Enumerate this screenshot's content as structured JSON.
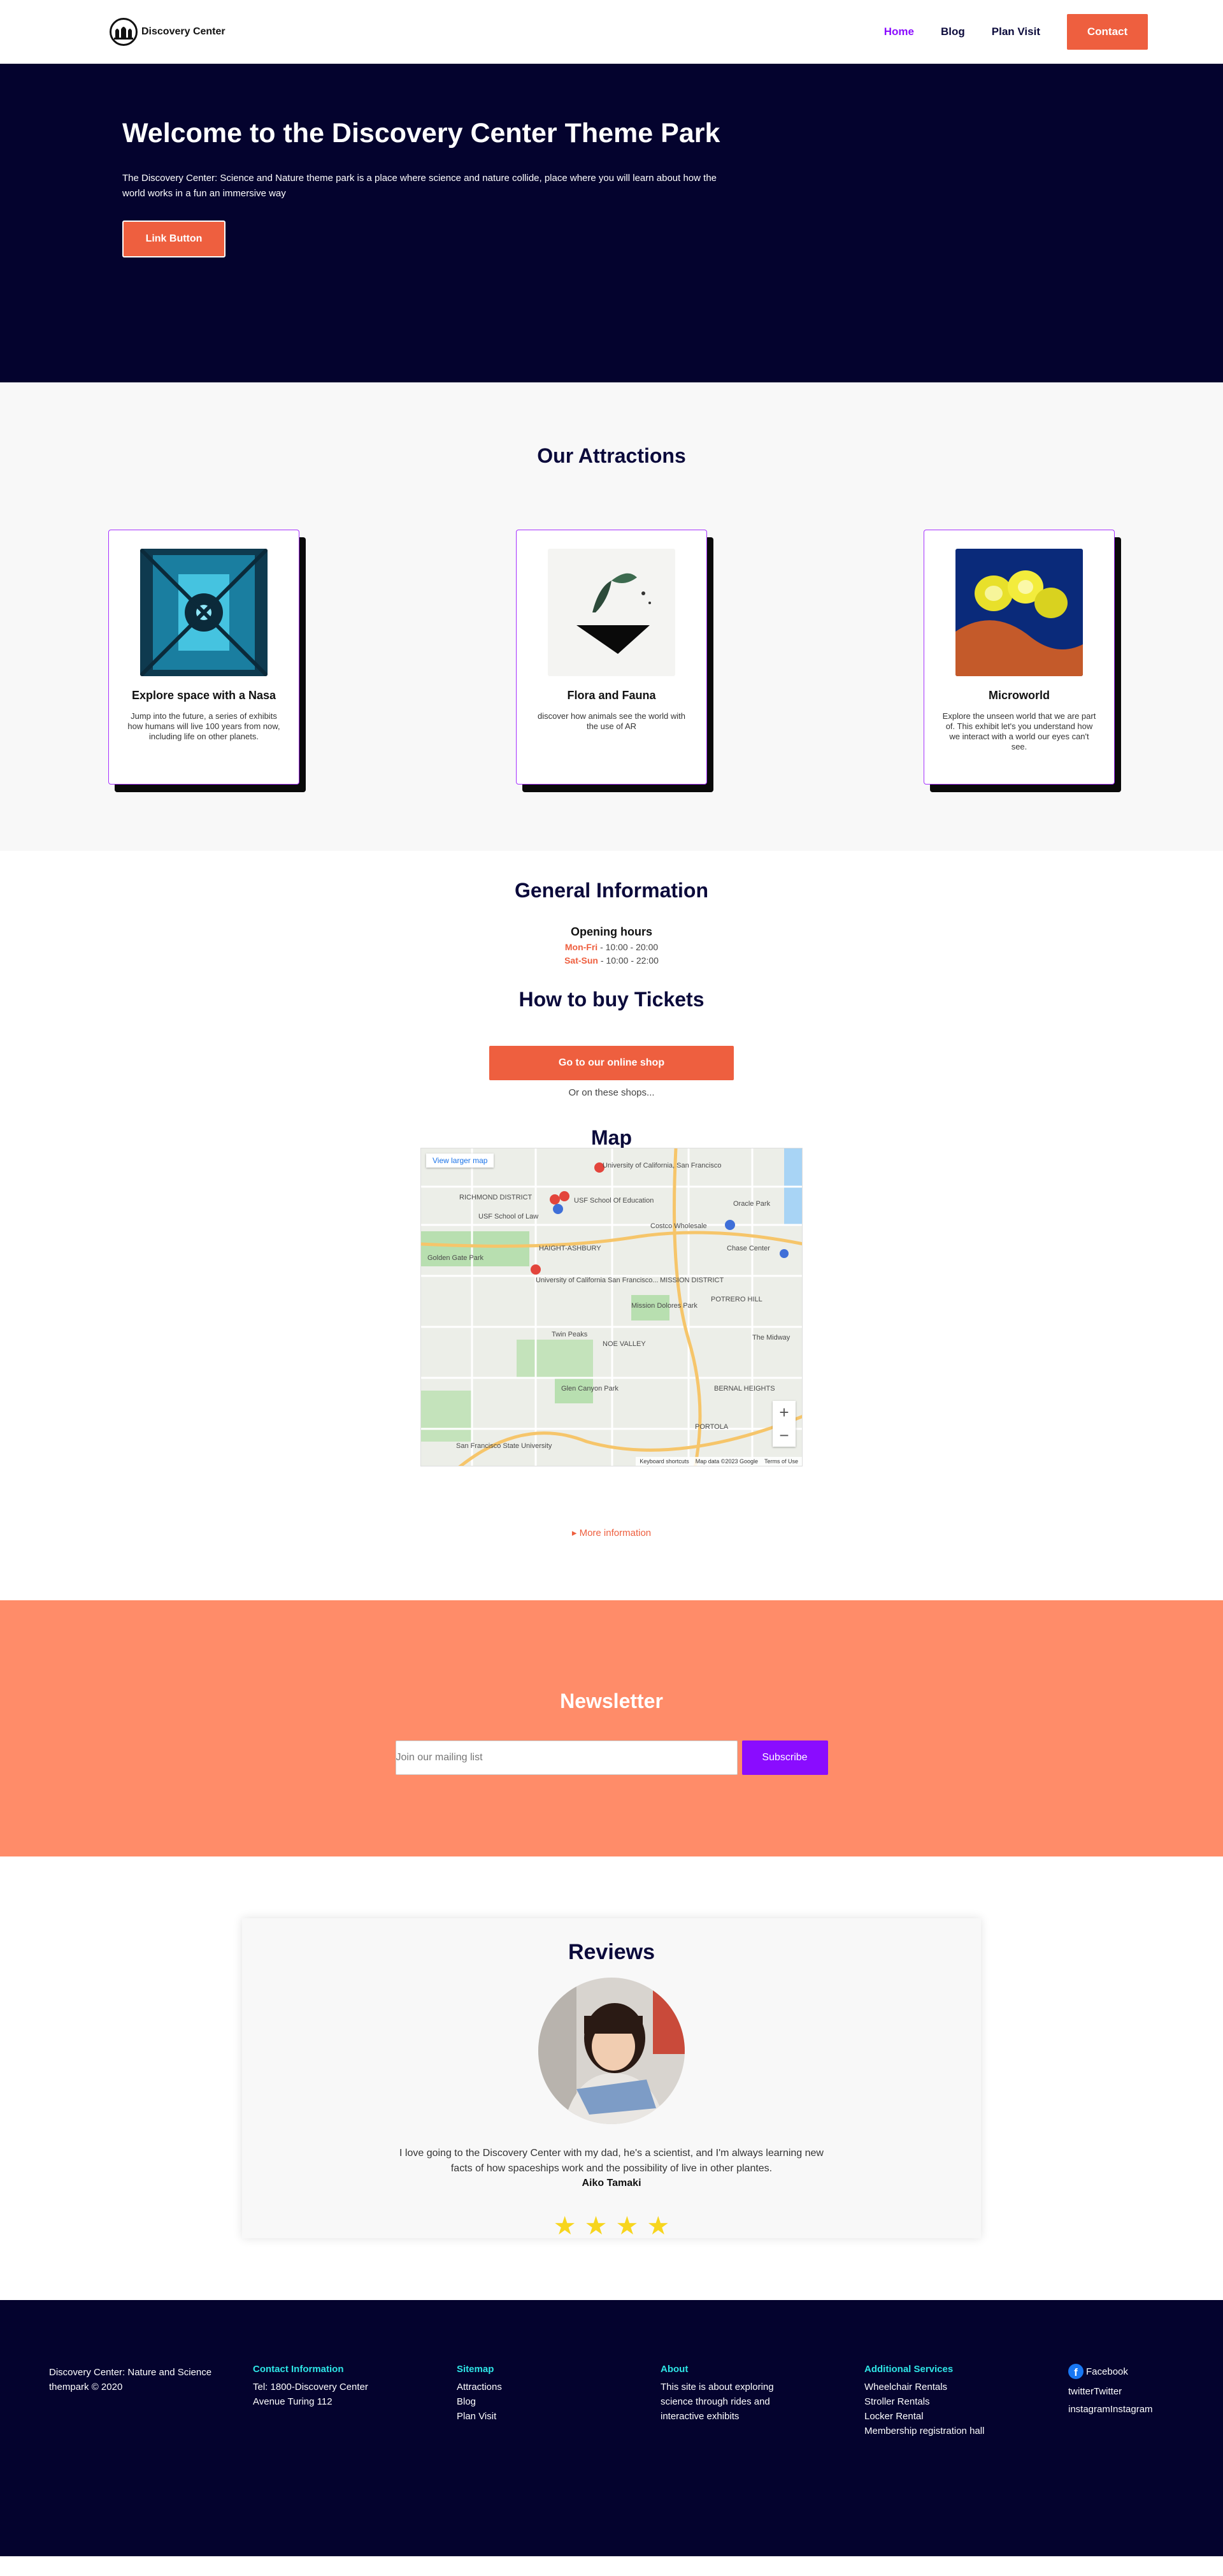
{
  "nav": {
    "brand": "Discovery Center",
    "links": [
      "Home",
      "Blog",
      "Plan Visit"
    ],
    "cta": "Contact"
  },
  "hero": {
    "title": "Welcome to the Discovery Center Theme Park",
    "text": "The Discovery Center: Science and Nature theme park is a place where science and nature collide, place where you will learn about how the world works in a fun an immersive way",
    "button": "Link Button"
  },
  "attractions": {
    "title": "Our Attractions",
    "cards": [
      {
        "title": "Explore space with a Nasa",
        "text": "Jump into the future, a series of exhibits how humans will live 100 years from now, including life on other planets."
      },
      {
        "title": "Flora and Fauna",
        "text": "discover how animals see the world with the use of AR"
      },
      {
        "title": "Microworld",
        "text": "Explore the unseen world that we are part of. This exhibit let's you understand how we interact with a world our eyes can't see."
      }
    ]
  },
  "general": {
    "title": "General Information",
    "hours_title": "Opening hours",
    "hours": [
      {
        "day": "Mon-Fri",
        "time": "- 10:00 - 20:00"
      },
      {
        "day": "Sat-Sun",
        "time": "- 10:00 - 22:00"
      }
    ]
  },
  "tickets": {
    "title": "How to buy Tickets",
    "button": "Go to our online shop",
    "alt_text": "Or on these shops..."
  },
  "map": {
    "title": "Map",
    "view_larger": "View larger map",
    "labels": [
      "University of California, San Francisco",
      "USF School Of Education",
      "USF School of Law",
      "RICHMOND DISTRICT",
      "HAIGHT-ASHBURY",
      "MISSION DISTRICT",
      "NOE VALLEY",
      "Twin Peaks",
      "Glen Canyon Park",
      "BERNAL HEIGHTS",
      "PORTOLA",
      "POTRERO HILL",
      "The Midway",
      "Costco Wholesale",
      "Oracle Park",
      "Chase Center",
      "Mission Dolores Park",
      "Golden Gate Park",
      "San Francisco State University",
      "University of California San Francisco..."
    ],
    "footer": [
      "Keyboard shortcuts",
      "Map data ©2023 Google",
      "Terms of Use"
    ],
    "more": "More information"
  },
  "newsletter": {
    "title": "Newsletter",
    "placeholder": "Join our mailing list",
    "button": "Subscribe"
  },
  "reviews": {
    "title": "Reviews",
    "quote": "I love going to the Discovery Center with my dad, he's a scientist, and I'm always learning new facts of how spaceships work and the possibility of live in other plantes.",
    "name": "Aiko Tamaki",
    "rating": 4
  },
  "footer": {
    "copyright": "Discovery Center: Nature and Science thempark © 2020",
    "contact": {
      "title": "Contact Information",
      "lines": [
        "Tel: 1800-Discovery Center",
        "Avenue Turing 112"
      ]
    },
    "sitemap": {
      "title": "Sitemap",
      "lines": [
        "Attractions",
        "Blog",
        "Plan Visit"
      ]
    },
    "about": {
      "title": "About",
      "text": "This site is about exploring science through rides and interactive exhibits"
    },
    "services": {
      "title": "Additional Services",
      "lines": [
        "Wheelchair Rentals",
        "Stroller Rentals",
        "Locker Rental",
        "Membership registration hall"
      ]
    },
    "social": [
      "Facebook",
      "twitterTwitter",
      "instagramInstagram"
    ]
  },
  "colors": {
    "navy": "#04032e",
    "accent_orange": "#ee5f3f",
    "newsletter_bg": "#ff8c69",
    "purple": "#8a0cff",
    "cyan": "#2ee6e6",
    "star": "#f7d51d"
  }
}
